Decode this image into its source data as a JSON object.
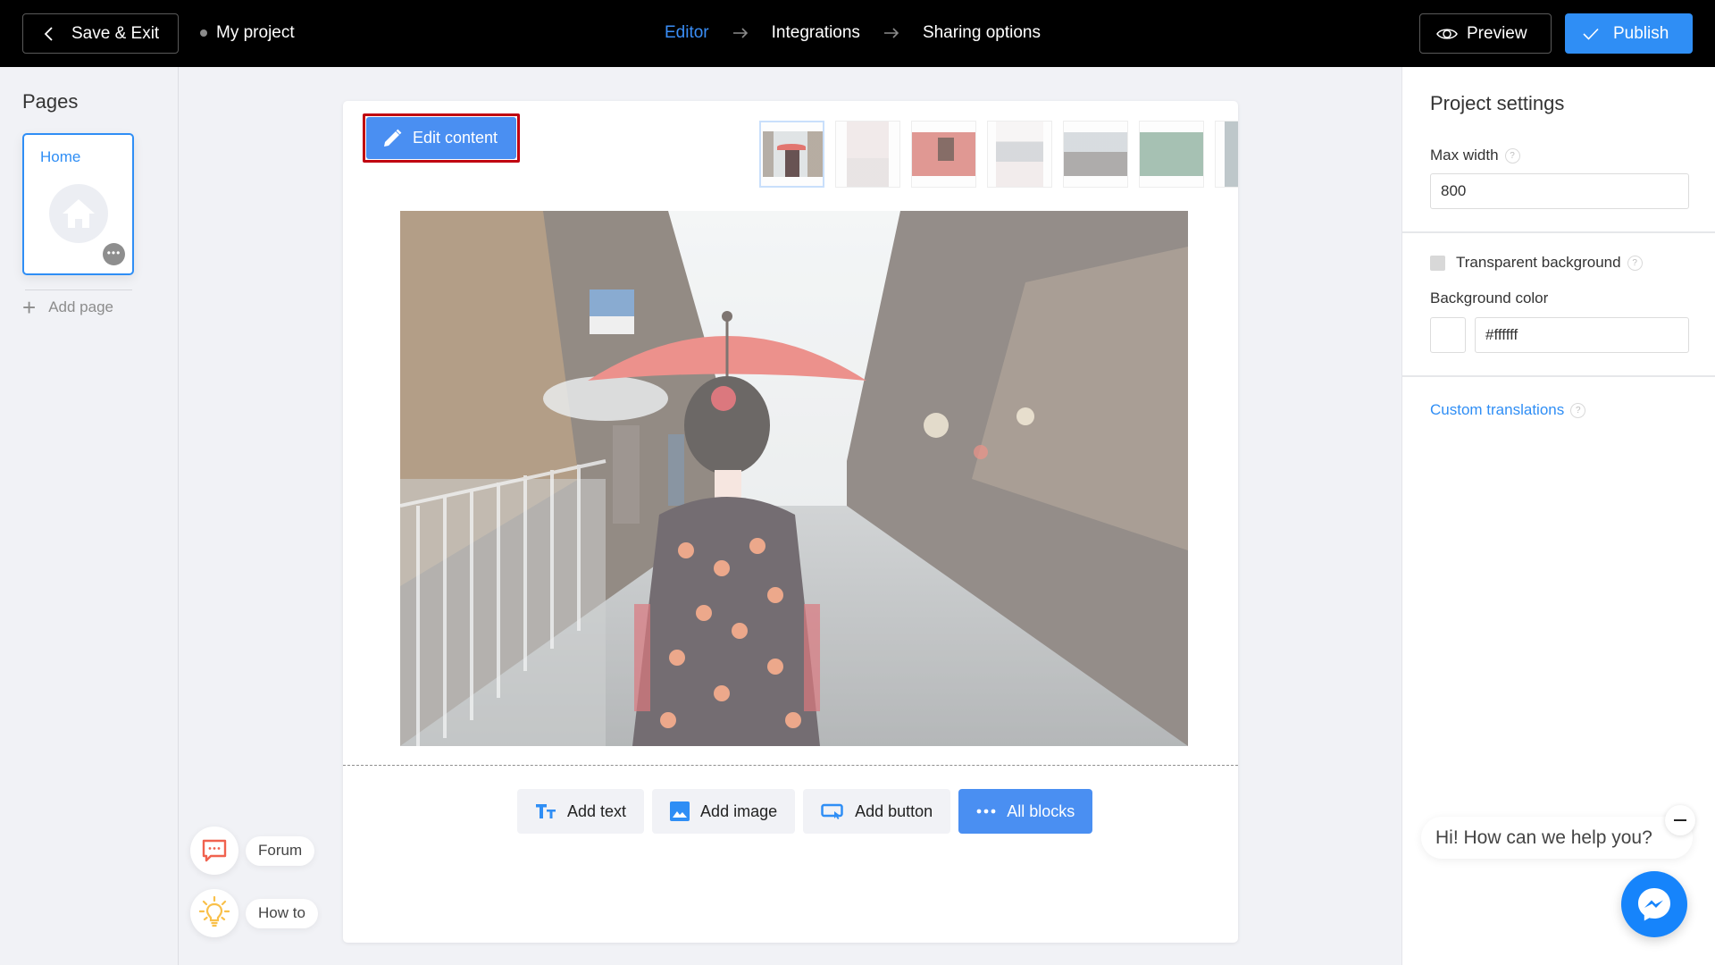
{
  "header": {
    "save_exit_label": "Save & Exit",
    "project_name": "My project",
    "steps": [
      {
        "label": "Editor",
        "active": true
      },
      {
        "label": "Integrations",
        "active": false
      },
      {
        "label": "Sharing options",
        "active": false
      }
    ],
    "preview_label": "Preview",
    "publish_label": "Publish"
  },
  "sidebar": {
    "title": "Pages",
    "pages": [
      {
        "label": "Home",
        "icon": "home-icon",
        "selected": true
      }
    ],
    "add_page_label": "Add page"
  },
  "help": {
    "forum_label": "Forum",
    "howto_label": "How to"
  },
  "canvas": {
    "edit_content_label": "Edit content",
    "thumbnails": [
      {
        "name": "geisha-umbrella",
        "selected": true
      },
      {
        "name": "cherry-blossom-reflection",
        "selected": false
      },
      {
        "name": "red-lantern",
        "selected": false
      },
      {
        "name": "castle-blossoms",
        "selected": false
      },
      {
        "name": "pagoda-sunset",
        "selected": false
      },
      {
        "name": "koi-pond",
        "selected": false
      },
      {
        "name": "street-partial",
        "selected": false
      }
    ],
    "main_image": "geisha-umbrella",
    "blocks": {
      "add_text": "Add text",
      "add_image": "Add image",
      "add_button": "Add button",
      "all_blocks": "All blocks"
    }
  },
  "settings": {
    "title": "Project settings",
    "max_width_label": "Max width",
    "max_width_value": "800",
    "transparent_bg_label": "Transparent background",
    "transparent_bg_checked": false,
    "bg_color_label": "Background color",
    "bg_color_value": "#ffffff",
    "custom_translations_label": "Custom translations",
    "help_glyph": "?"
  },
  "chat": {
    "greeting": "Hi! How can we help you?"
  },
  "colors": {
    "accent": "#2f8ef5",
    "header_bg": "#000000",
    "highlight_outline": "#c00010",
    "forum_icon": "#f0624f",
    "howto_icon": "#f9c04a",
    "messenger": "#1684fb"
  }
}
